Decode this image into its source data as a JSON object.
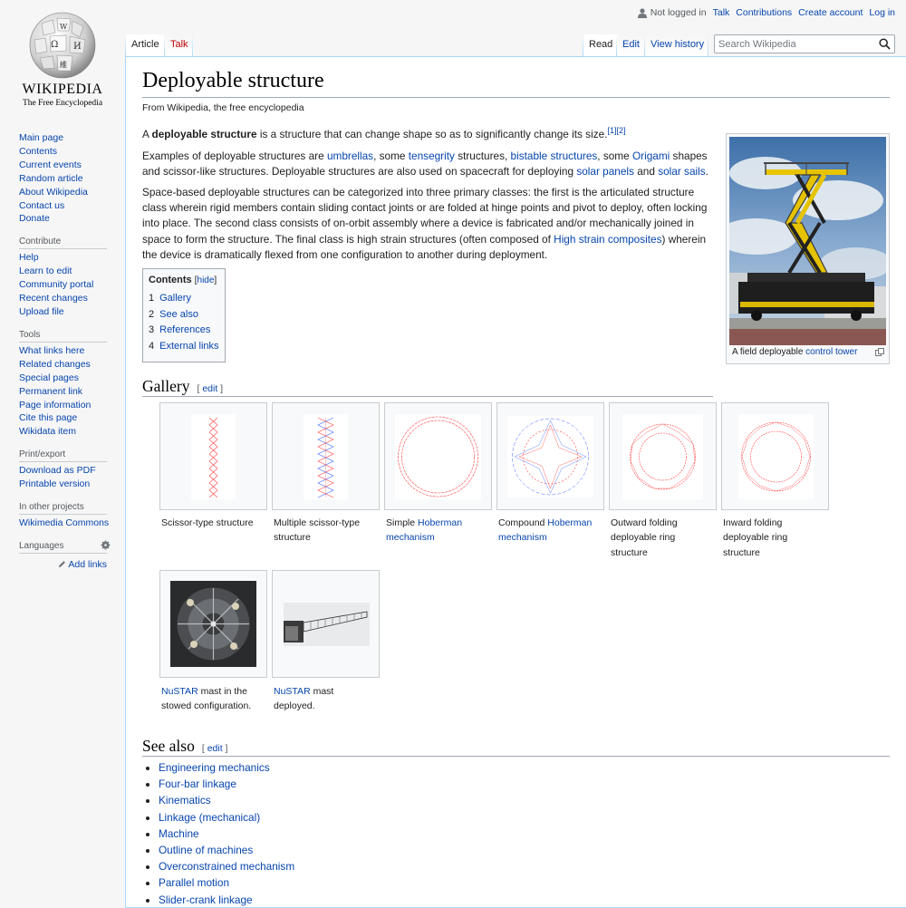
{
  "logo": {
    "wordmark": "WIKIPEDIA",
    "tagline": "The Free Encyclopedia",
    "glyphs": [
      "Ω",
      "W",
      "И",
      "維"
    ]
  },
  "sidebar": {
    "navigation": [
      "Main page",
      "Contents",
      "Current events",
      "Random article",
      "About Wikipedia",
      "Contact us",
      "Donate"
    ],
    "contribute": {
      "title": "Contribute",
      "items": [
        "Help",
        "Learn to edit",
        "Community portal",
        "Recent changes",
        "Upload file"
      ]
    },
    "tools": {
      "title": "Tools",
      "items": [
        "What links here",
        "Related changes",
        "Special pages",
        "Permanent link",
        "Page information",
        "Cite this page",
        "Wikidata item"
      ]
    },
    "print": {
      "title": "Print/export",
      "items": [
        "Download as PDF",
        "Printable version"
      ]
    },
    "other": {
      "title": "In other projects",
      "items": [
        "Wikimedia Commons"
      ]
    },
    "languages": {
      "title": "Languages",
      "add_links": "Add links"
    }
  },
  "personal": {
    "not_logged_in": "Not logged in",
    "talk": "Talk",
    "contributions": "Contributions",
    "create_account": "Create account",
    "log_in": "Log in"
  },
  "tabs": {
    "article": "Article",
    "talk": "Talk",
    "read": "Read",
    "edit": "Edit",
    "history": "View history"
  },
  "search": {
    "placeholder": "Search Wikipedia"
  },
  "article": {
    "title": "Deployable structure",
    "subtitle": "From Wikipedia, the free encyclopedia",
    "p1": {
      "a": "A ",
      "bold": "deployable structure",
      "b": " is a structure that can change shape so as to significantly change its size.",
      "ref1": "[1]",
      "ref2": "[2]"
    },
    "p2": {
      "t1": "Examples of deployable structures are ",
      "l1": "umbrellas",
      "t2": ", some ",
      "l2": "tensegrity",
      "t3": " structures, ",
      "l3": "bistable structures",
      "t4": ", some ",
      "l4": "Origami",
      "t5": " shapes and scissor-like structures. Deployable structures are also used on spacecraft for deploying ",
      "l5": "solar panels",
      "t6": " and ",
      "l6": "solar sails",
      "t7": "."
    },
    "p3": {
      "t1": "Space-based deployable structures can be categorized into three primary classes: the first is the articulated structure class wherein rigid members contain sliding contact joints or are folded at hinge points and pivot to deploy, often locking into place. The second class consists of on-orbit assembly where a device is fabricated and/or mechanically joined in space to form the structure. The final class is high strain structures (often composed of ",
      "l1": "High strain composites",
      "t2": ") wherein the device is dramatically flexed from one configuration to another during deployment."
    },
    "thumb": {
      "caption_text": "A field deployable ",
      "caption_link": "control tower"
    },
    "toc": {
      "title": "Contents",
      "hide": "hide",
      "items": [
        {
          "num": "1",
          "label": "Gallery"
        },
        {
          "num": "2",
          "label": "See also"
        },
        {
          "num": "3",
          "label": "References"
        },
        {
          "num": "4",
          "label": "External links"
        }
      ]
    },
    "gallery": {
      "heading": "Gallery",
      "edit": "edit",
      "captions": [
        {
          "text": "Scissor-type structure"
        },
        {
          "text": "Multiple scissor-type structure"
        },
        {
          "pre": "Simple ",
          "link": "Hoberman mechanism"
        },
        {
          "pre": "Compound ",
          "link": "Hoberman mechanism"
        },
        {
          "text": "Outward folding deployable ring structure"
        },
        {
          "text": "Inward folding deployable ring structure"
        },
        {
          "link": "NuSTAR",
          "post": " mast in the stowed configuration."
        },
        {
          "link": "NuSTAR",
          "post": " mast deployed."
        }
      ]
    },
    "see_also": {
      "heading": "See also",
      "edit": "edit",
      "items": [
        "Engineering mechanics",
        "Four-bar linkage",
        "Kinematics",
        "Linkage (mechanical)",
        "Machine",
        "Outline of machines",
        "Overconstrained mechanism",
        "Parallel motion",
        "Slider-crank linkage"
      ]
    }
  },
  "colors": {
    "link": "#0645ad",
    "redlink": "#ba0000",
    "border": "#a2a9b1",
    "tab_border": "#a7d7f9",
    "diagram_red": "#ff4444",
    "diagram_blue": "#4466ff"
  }
}
